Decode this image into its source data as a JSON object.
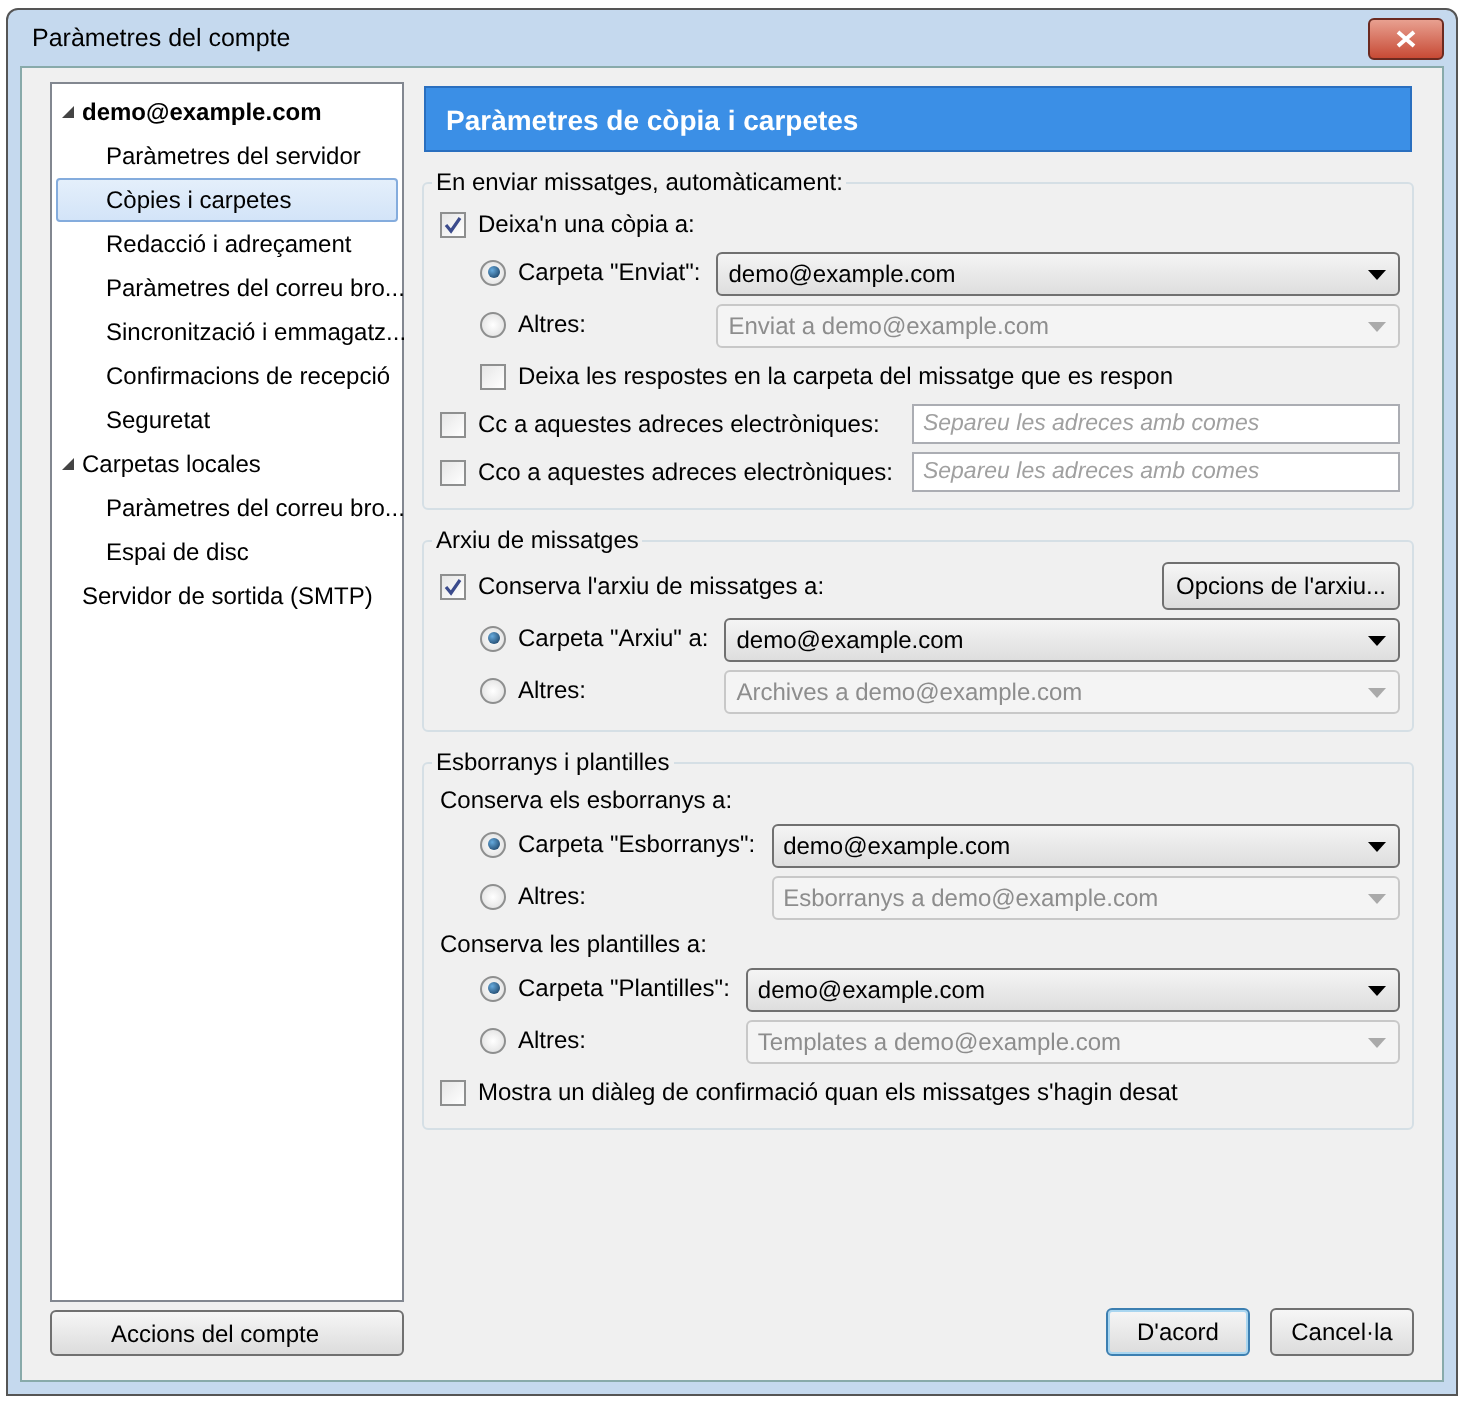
{
  "window": {
    "title": "Paràmetres del compte"
  },
  "sidebar": {
    "tree": [
      {
        "label": "demo@example.com",
        "bold": true,
        "expanded": true,
        "selected": false,
        "children": [
          {
            "label": "Paràmetres del servidor",
            "selected": false
          },
          {
            "label": "Còpies i carpetes",
            "selected": true
          },
          {
            "label": "Redacció i adreçament",
            "selected": false
          },
          {
            "label": "Paràmetres del correu bro...",
            "selected": false
          },
          {
            "label": "Sincronització i emmagatz...",
            "selected": false
          },
          {
            "label": "Confirmacions de recepció",
            "selected": false
          },
          {
            "label": "Seguretat",
            "selected": false
          }
        ]
      },
      {
        "label": "Carpetas locales",
        "bold": false,
        "expanded": true,
        "selected": false,
        "children": [
          {
            "label": "Paràmetres del correu bro...",
            "selected": false
          },
          {
            "label": "Espai de disc",
            "selected": false
          }
        ]
      },
      {
        "label": "Servidor de sortida (SMTP)",
        "bold": false,
        "selected": false
      }
    ],
    "actions_button": "Accions del compte"
  },
  "panel": {
    "title": "Paràmetres de còpia i carpetes",
    "sections": [
      {
        "title": "En enviar missatges, automàticament:",
        "rows": [
          {
            "kind": "checkbox",
            "label": "Deixa'n una còpia a:",
            "checked": true
          },
          {
            "kind": "radios",
            "options": [
              {
                "label": "Carpeta \"Enviat\":",
                "selected": true,
                "value": "demo@example.com",
                "disabled": false
              },
              {
                "label": "Altres:",
                "selected": false,
                "value": "Enviat a demo@example.com",
                "disabled": true
              }
            ]
          },
          {
            "kind": "subcheckbox",
            "label": "Deixa les respostes en la carpeta del missatge que es respon",
            "checked": false
          },
          {
            "kind": "fields",
            "options": [
              {
                "label": "Cc a aquestes adreces electròniques:",
                "checked": false,
                "placeholder": "Separeu les adreces amb comes"
              },
              {
                "label": "Cco a aquestes adreces electròniques:",
                "checked": false,
                "placeholder": "Separeu les adreces amb comes"
              }
            ]
          }
        ]
      },
      {
        "title": "Arxiu de missatges",
        "rows": [
          {
            "kind": "checkbutton",
            "label": "Conserva l'arxiu de missatges a:",
            "checked": true,
            "button": "Opcions de l'arxiu..."
          },
          {
            "kind": "radios",
            "options": [
              {
                "label": "Carpeta \"Arxiu\" a:",
                "selected": true,
                "value": "demo@example.com",
                "disabled": false
              },
              {
                "label": "Altres:",
                "selected": false,
                "value": "Archives a demo@example.com",
                "disabled": true
              }
            ]
          }
        ]
      },
      {
        "title": "Esborranys i plantilles",
        "rows": [
          {
            "kind": "label",
            "label": "Conserva els esborranys a:"
          },
          {
            "kind": "radios",
            "options": [
              {
                "label": "Carpeta \"Esborranys\":",
                "selected": true,
                "value": "demo@example.com",
                "disabled": false
              },
              {
                "label": "Altres:",
                "selected": false,
                "value": "Esborranys a demo@example.com",
                "disabled": true
              }
            ]
          },
          {
            "kind": "label",
            "label": "Conserva les plantilles a:"
          },
          {
            "kind": "radios",
            "options": [
              {
                "label": "Carpeta \"Plantilles\":",
                "selected": true,
                "value": "demo@example.com",
                "disabled": false
              },
              {
                "label": "Altres:",
                "selected": false,
                "value": "Templates a demo@example.com",
                "disabled": true
              }
            ]
          },
          {
            "kind": "checkbox",
            "label": "Mostra un diàleg de confirmació quan els missatges s'hagin desat",
            "checked": false
          }
        ]
      }
    ]
  },
  "buttons": [
    {
      "label": "D'acord",
      "default": true
    },
    {
      "label": "Cancel·la",
      "default": false
    }
  ]
}
